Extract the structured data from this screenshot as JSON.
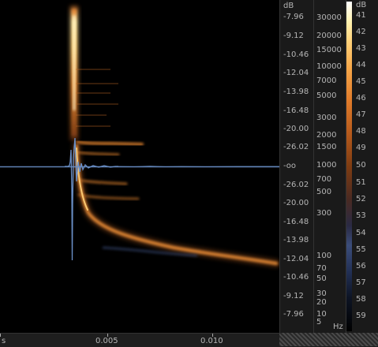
{
  "colors": {
    "waveform": "#6a8fc7",
    "spectrogram_hot": "#ffd27a",
    "spectrogram_mid": "#e07b2a",
    "background": "#000000"
  },
  "db_scale": {
    "unit": "dB",
    "labels": [
      "-7.96",
      "-9.12",
      "-10.46",
      "-12.04",
      "-13.98",
      "-16.48",
      "-20.00",
      "-26.02",
      "-oo",
      "-26.02",
      "-20.00",
      "-16.48",
      "-13.98",
      "-12.04",
      "-10.46",
      "-9.12",
      "-7.96"
    ]
  },
  "hz_scale": {
    "unit": "Hz",
    "labels": [
      "30000",
      "20000",
      "15000",
      "10000",
      "7000",
      "5000",
      "3000",
      "2000",
      "1500",
      "1000",
      "700",
      "500",
      "300",
      "100",
      "70",
      "50",
      "30",
      "20",
      "10",
      "5"
    ]
  },
  "colorbar": {
    "unit": "dB",
    "labels": [
      "41",
      "42",
      "43",
      "44",
      "45",
      "46",
      "47",
      "48",
      "49",
      "50",
      "51",
      "52",
      "53",
      "54",
      "55",
      "56",
      "57",
      "58",
      "59"
    ]
  },
  "time_axis": {
    "labels": [
      "s",
      "0.005",
      "0.010"
    ]
  }
}
